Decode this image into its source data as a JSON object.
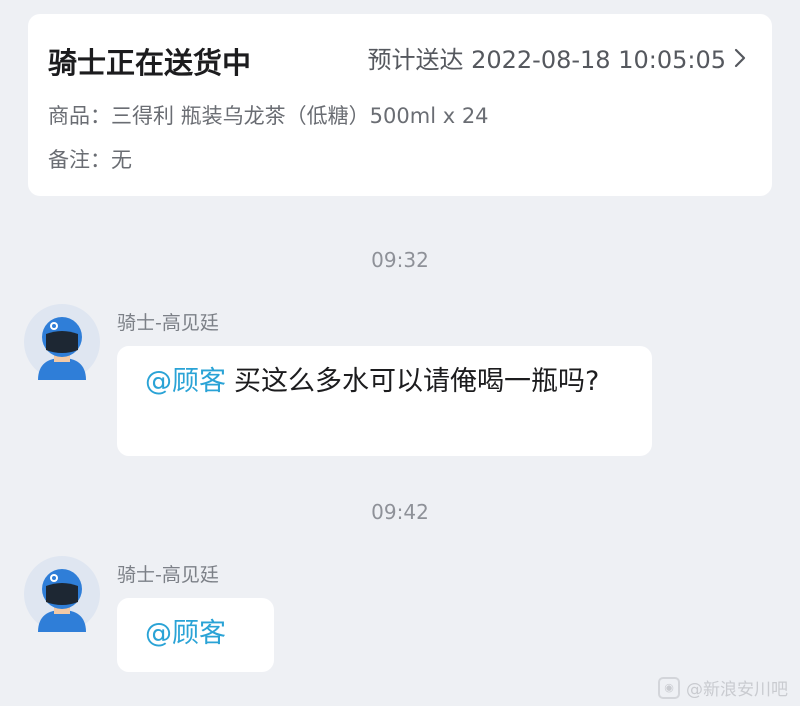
{
  "order": {
    "status_title": "骑士正在送货中",
    "eta_text": "预计送达 2022-08-18 10:05:05",
    "goods_text": "商品：三得利 瓶装乌龙茶（低糖）500ml x 24",
    "note_text": "备注：无"
  },
  "chat": {
    "messages": [
      {
        "time": "09:32",
        "sender": "骑士-高见廷",
        "mention": "@顾客",
        "text": "买这么多水可以请俺喝一瓶吗?"
      },
      {
        "time": "09:42",
        "sender": "骑士-高见廷",
        "mention": "@顾客",
        "text": ""
      }
    ]
  },
  "watermark": {
    "text": "@新浪安川吧"
  },
  "icons": {
    "eta_chevron": "chevron-right-icon",
    "rider_avatar": "rider-helmet-avatar-icon",
    "watermark_logo": "weibo-logo-icon"
  },
  "colors": {
    "background": "#eef0f4",
    "card": "#ffffff",
    "mention": "#2aa3d6",
    "avatar_helmet": "#2f7ed8"
  }
}
